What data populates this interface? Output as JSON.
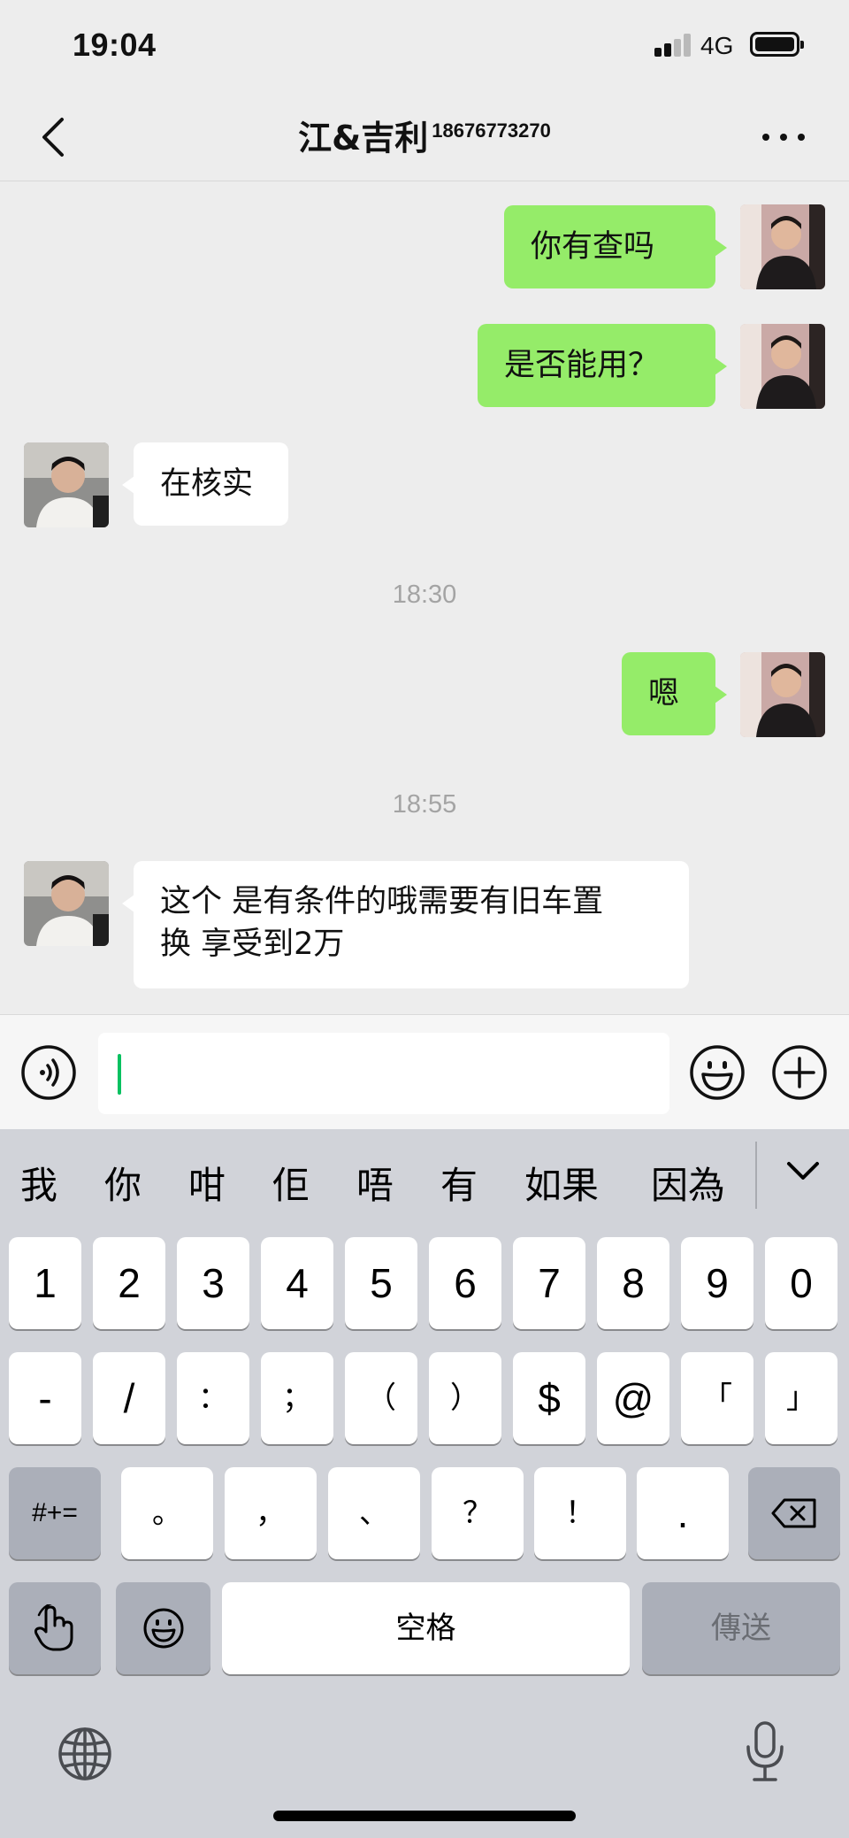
{
  "status_bar": {
    "time": "19:04",
    "network": "4G"
  },
  "nav": {
    "name": "江&吉利",
    "phone": "18676773270",
    "back_icon": "chevron-left-icon",
    "more_icon": "ellipsis-icon"
  },
  "messages": [
    {
      "from": "me",
      "text": "你有查吗"
    },
    {
      "from": "me",
      "text": "是否能用？"
    },
    {
      "from": "other",
      "text": "在核实"
    },
    {
      "timestamp": "18:30"
    },
    {
      "from": "me",
      "text": "嗯"
    },
    {
      "timestamp": "18:55"
    },
    {
      "from": "other",
      "text": "这个 是有条件的哦需要有旧车置换 享受到2万",
      "lines": [
        "这个 是有条件的哦需要有旧车置",
        "换 享受到2万"
      ]
    }
  ],
  "input": {
    "value": "",
    "voice_icon": "voice-icon",
    "emoji_icon": "emoji-icon",
    "plus_icon": "plus-icon"
  },
  "keyboard": {
    "suggestions": [
      "我",
      "你",
      "咁",
      "佢",
      "唔",
      "有",
      "如果",
      "因為"
    ],
    "row1": [
      "1",
      "2",
      "3",
      "4",
      "5",
      "6",
      "7",
      "8",
      "9",
      "0"
    ],
    "row2": [
      "-",
      "/",
      "：",
      "；",
      "（",
      "）",
      "$",
      "@",
      "「",
      "」"
    ],
    "row3": [
      "。",
      "，",
      "、",
      "？",
      "！",
      "."
    ],
    "symbols_key": "#+=",
    "space_key": "空格",
    "send_key": "傳送"
  },
  "colors": {
    "outgoing_bubble": "#95ec69",
    "incoming_bubble": "#ffffff",
    "background": "#ededed",
    "caret": "#07c160"
  }
}
